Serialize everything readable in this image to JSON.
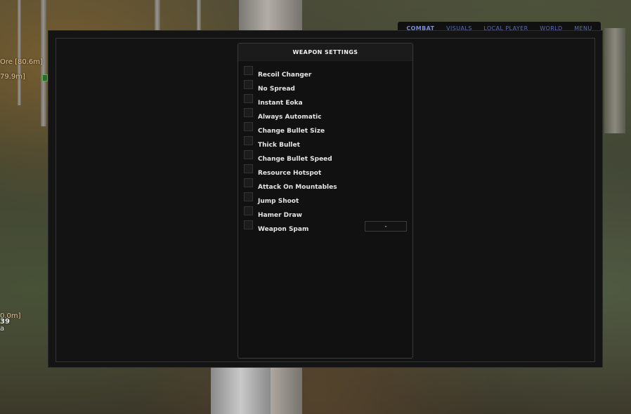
{
  "tabs": [
    {
      "label": "COMBAT",
      "active": true
    },
    {
      "label": "VISUALS",
      "active": false
    },
    {
      "label": "LOCAL PLAYER",
      "active": false
    },
    {
      "label": "WORLD",
      "active": false
    },
    {
      "label": "MENU",
      "active": false
    }
  ],
  "panel": {
    "title": "WEAPON SETTINGS",
    "options": [
      {
        "label": "Recoil Changer",
        "checked": false
      },
      {
        "label": "No Spread",
        "checked": false
      },
      {
        "label": "Instant Eoka",
        "checked": false
      },
      {
        "label": "Always Automatic",
        "checked": false
      },
      {
        "label": "Change Bullet Size",
        "checked": false
      },
      {
        "label": "Thick Bullet",
        "checked": false
      },
      {
        "label": "Change Bullet Speed",
        "checked": false
      },
      {
        "label": "Resource Hotspot",
        "checked": false
      },
      {
        "label": "Attack On Mountables",
        "checked": false
      },
      {
        "label": "Jump Shoot",
        "checked": false
      },
      {
        "label": "Hamer Draw",
        "checked": false
      },
      {
        "label": "Weapon Spam",
        "checked": false
      }
    ],
    "weapon_spam_keybind": "-"
  },
  "hud": {
    "ore_label": "Ore [80.6m]",
    "distance_label": "79.9m]",
    "lower_distance": "0.0m]",
    "lower_number": "39",
    "lower_text": "a"
  },
  "colors": {
    "tab_text": "#5a6dbd",
    "window_bg": "#141414",
    "panel_bg": "#111111"
  }
}
